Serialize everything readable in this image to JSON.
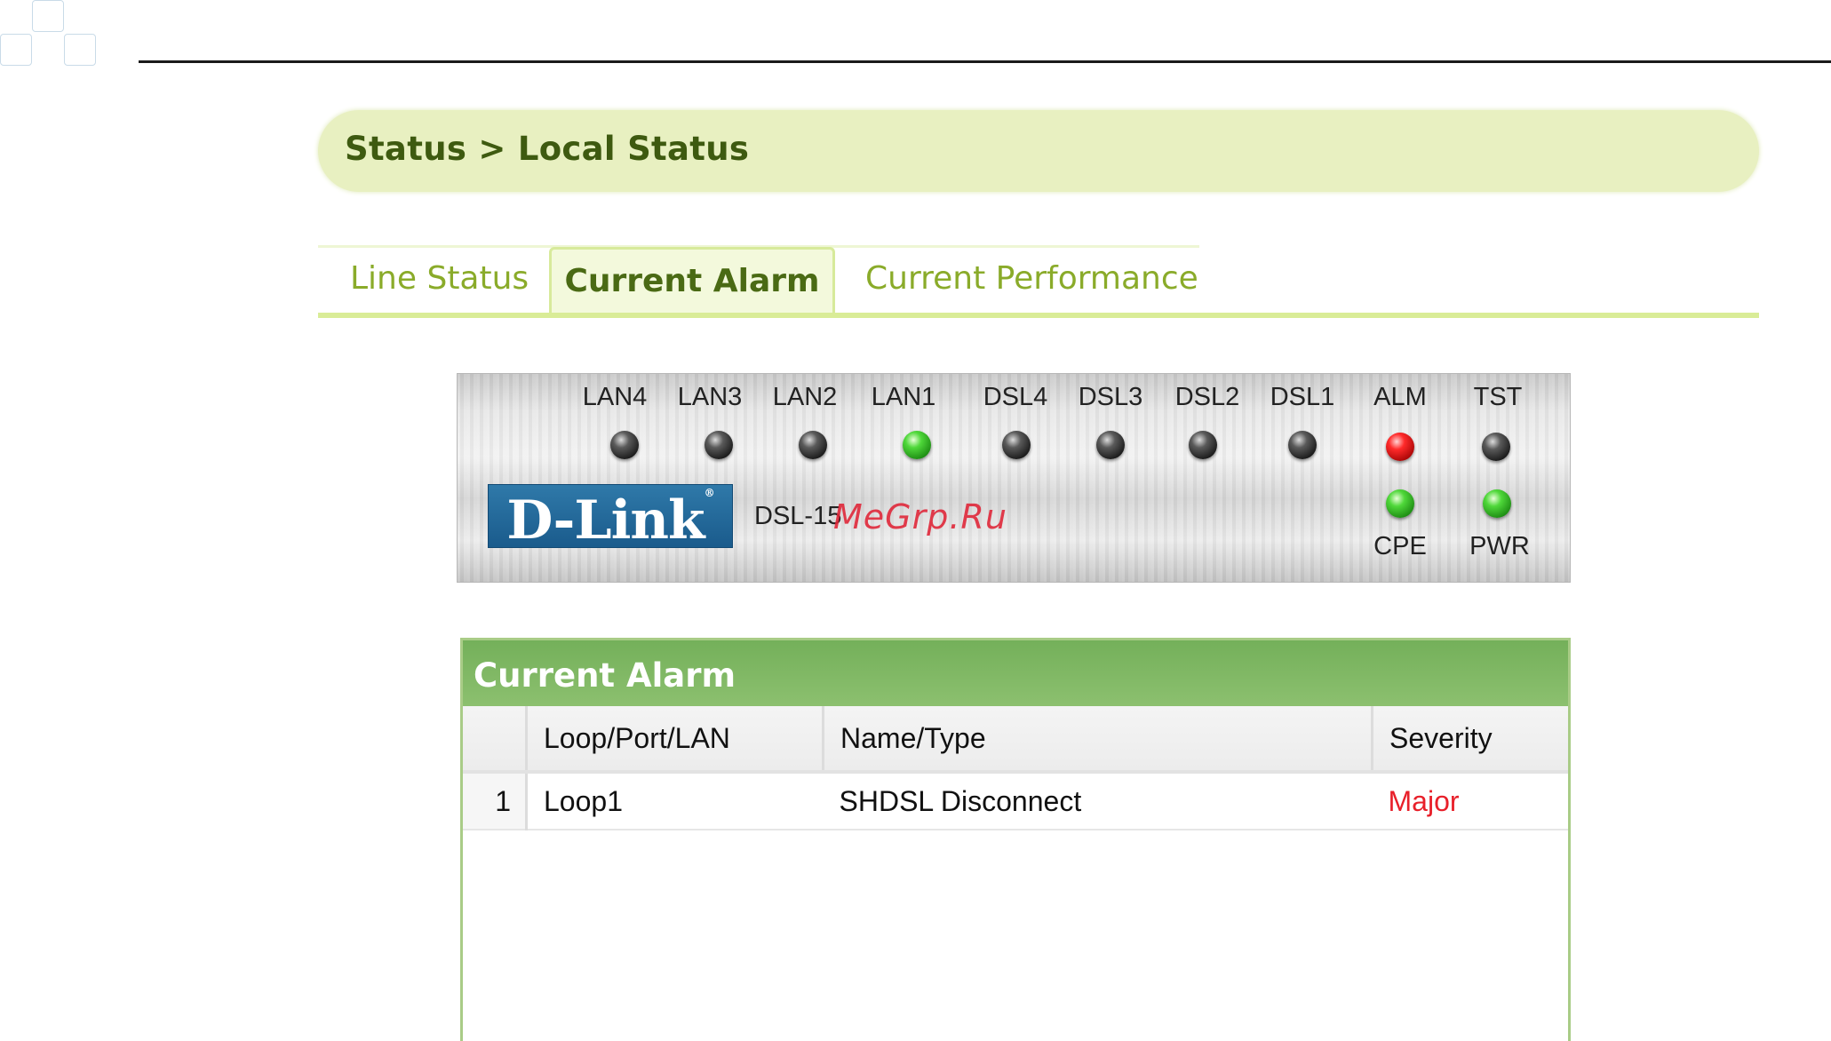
{
  "breadcrumb": {
    "text": "Status > Local Status"
  },
  "tabs": [
    {
      "label": "Line Status",
      "active": false
    },
    {
      "label": "Current Alarm",
      "active": true
    },
    {
      "label": "Current Performance",
      "active": false
    }
  ],
  "device": {
    "logo": "D-Link",
    "model": "DSL-15",
    "leds": [
      {
        "label": "LAN4",
        "state": "off"
      },
      {
        "label": "LAN3",
        "state": "off"
      },
      {
        "label": "LAN2",
        "state": "off"
      },
      {
        "label": "LAN1",
        "state": "green"
      },
      {
        "label": "DSL4",
        "state": "off"
      },
      {
        "label": "DSL3",
        "state": "off"
      },
      {
        "label": "DSL2",
        "state": "off"
      },
      {
        "label": "DSL1",
        "state": "off"
      },
      {
        "label": "ALM",
        "state": "red"
      },
      {
        "label": "TST",
        "state": "off"
      }
    ],
    "bottom_leds": [
      {
        "label": "CPE",
        "state": "green"
      },
      {
        "label": "PWR",
        "state": "green"
      }
    ]
  },
  "watermark": "MeGrp.Ru",
  "alarm_panel": {
    "title": "Current Alarm",
    "columns": [
      "",
      "Loop/Port/LAN",
      "Name/Type",
      "Severity"
    ],
    "rows": [
      {
        "index": "1",
        "loop": "Loop1",
        "name": "SHDSL Disconnect",
        "severity": "Major"
      }
    ]
  },
  "colors": {
    "accent_green": "#8cc06f",
    "breadcrumb_bg": "#e8f0c1",
    "severity_major": "#e8202a"
  }
}
